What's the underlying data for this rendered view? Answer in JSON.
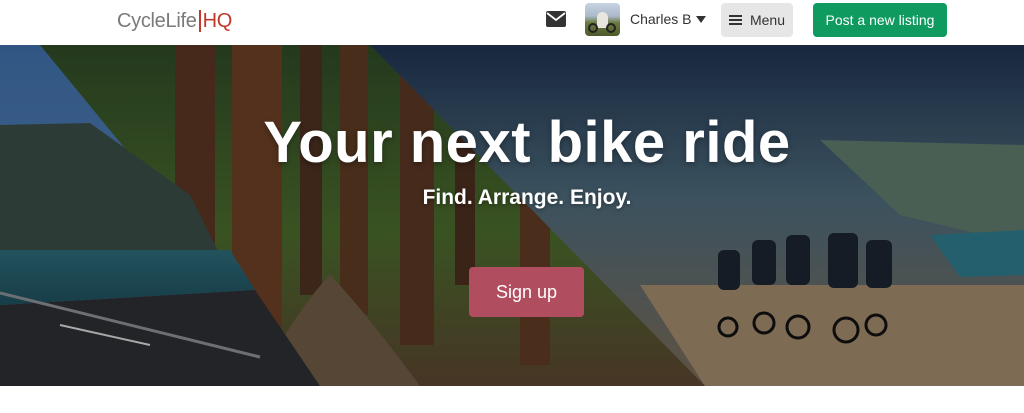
{
  "header": {
    "logo": {
      "main": "CycleLife",
      "suffix": "HQ"
    },
    "user": {
      "name": "Charles B"
    },
    "menu_label": "Menu",
    "post_listing_label": "Post a new listing"
  },
  "hero": {
    "title": "Your next bike ride",
    "subtitle": "Find. Arrange. Enjoy.",
    "signup_label": "Sign up"
  },
  "colors": {
    "brand_accent": "#c0392b",
    "post_button": "#0f9b5f",
    "signup_button": "#b04d5f",
    "menu_button": "#e6e6e6"
  },
  "icons": [
    "mail-icon",
    "chevron-down-icon",
    "menu-icon"
  ]
}
